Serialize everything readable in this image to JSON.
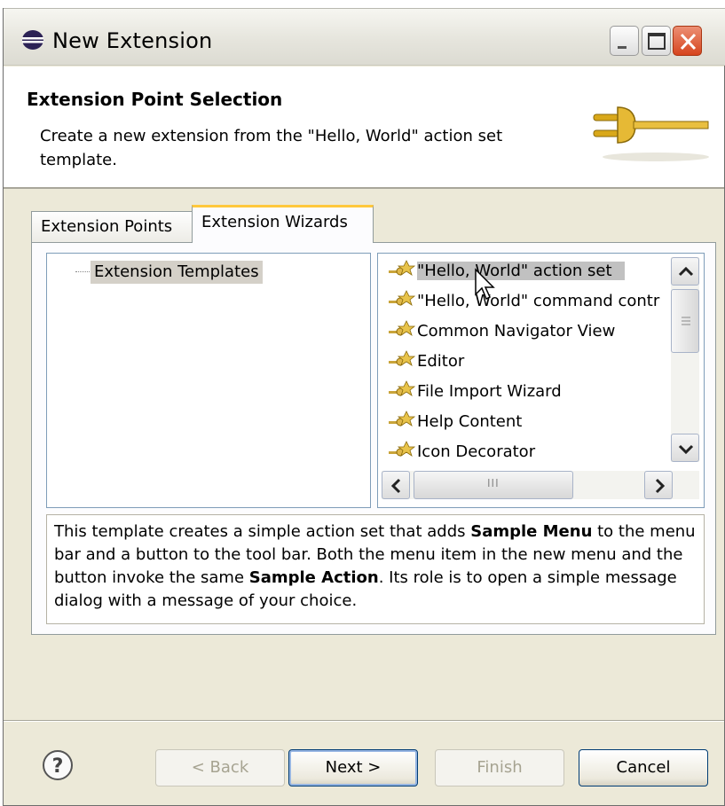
{
  "window": {
    "title": "New Extension"
  },
  "header": {
    "title": "Extension Point Selection",
    "description": "Create a new extension from the \"Hello, World\" action set template."
  },
  "tabs": [
    {
      "label": "Extension Points",
      "selected": false
    },
    {
      "label": "Extension Wizards",
      "selected": true
    }
  ],
  "tree": {
    "items": [
      {
        "label": "Extension Templates",
        "selected": true
      }
    ]
  },
  "wizards": {
    "items": [
      {
        "label": "\"Hello, World\" action set",
        "selected": true
      },
      {
        "label": "\"Hello, World\" command contr",
        "selected": false
      },
      {
        "label": "Common Navigator View",
        "selected": false
      },
      {
        "label": "Editor",
        "selected": false
      },
      {
        "label": "File Import Wizard",
        "selected": false
      },
      {
        "label": "Help Content",
        "selected": false
      },
      {
        "label": "Icon Decorator",
        "selected": false
      }
    ],
    "horizontal_scroll_marker": "III"
  },
  "description": {
    "part1": "This template creates a simple action set that adds ",
    "bold1": "Sample Menu",
    "part2": " to the menu bar and a button to the tool bar. Both the menu item in the new menu and the button invoke the same ",
    "bold2": "Sample Action",
    "part3": ". Its role is to open a simple message dialog with a message of your choice."
  },
  "buttons": {
    "help": "?",
    "back": "< Back",
    "next": "Next >",
    "finish": "Finish",
    "cancel": "Cancel"
  },
  "colors": {
    "dialog_bg": "#ece9d8",
    "selection": "#c1c1c1",
    "tab_highlight": "#ffc83c",
    "close_button": "#d6451e"
  }
}
